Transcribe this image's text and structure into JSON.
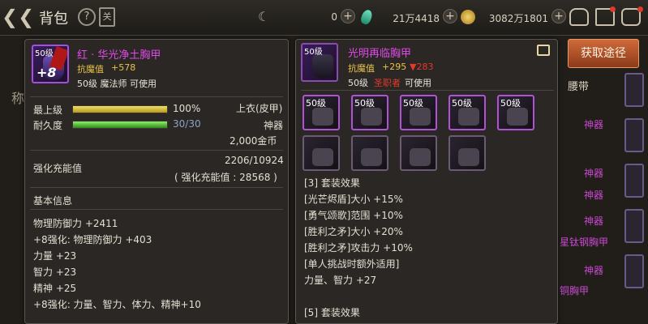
{
  "topbar": {
    "title": "背包",
    "help_glyph": "?",
    "book_glyph": "关",
    "currency_1": "0",
    "currency_2": "21万4418",
    "currency_3": "3082万1801"
  },
  "get_button_label": "获取途径",
  "background": {
    "left_text": "称",
    "belt_tab": "腰带",
    "right_rows": [
      "神器",
      "神器",
      "神器",
      "神器",
      "星钛钢胸甲",
      "神器",
      "铜胸甲"
    ]
  },
  "left_item": {
    "level_tag": "50级",
    "enhance_tag": "+8",
    "name": "红 · 华光净土胸甲",
    "resist_label": "抗魔值",
    "resist_value": "+578",
    "requirement": "50级 魔法师 可使用",
    "top_level_label": "最上级",
    "top_level_fraction": 1.0,
    "top_level_value": "100%",
    "durability_label": "耐久度",
    "durability_fraction": 1.0,
    "durability_value": "30/30",
    "slot_type": "上衣(皮甲)",
    "rarity": "神器",
    "price": "2,000金币",
    "charge_label": "强化充能值",
    "charge_value": "2206/10924",
    "charge_extra": "( 强化充能值 : 28568 )",
    "basic_info_label": "基本信息",
    "stats": [
      {
        "text": "物理防御力 +2411",
        "color": "white"
      },
      {
        "text": "+8强化: 物理防御力 +403",
        "color": "blue"
      },
      {
        "text": "力量 +23",
        "color": "white"
      },
      {
        "text": "智力 +23",
        "color": "white"
      },
      {
        "text": "精神 +25",
        "color": "white"
      },
      {
        "text": "+8强化: 力量、智力、体力、精神+10",
        "color": "blue"
      }
    ]
  },
  "right_item": {
    "level_tag": "50级",
    "name": "光明再临胸甲",
    "resist_label": "抗魔值",
    "resist_value": "+295",
    "resist_diff": "▼283",
    "req_level": "50级",
    "req_class": "圣职者",
    "req_usable": "可使用",
    "set_slots": [
      "50级",
      "50级",
      "50级",
      "50级",
      "50级",
      "",
      "",
      "",
      ""
    ],
    "set_effects": [
      "[3] 套装效果",
      "[光芒烬盾]大小 +15%",
      "[勇气颂歌]范围 +10%",
      "[胜利之矛]大小 +20%",
      "[胜利之矛]攻击力 +10%",
      "[单人挑战时额外适用]",
      "力量、智力 +27",
      "",
      "[5] 套装效果"
    ]
  }
}
